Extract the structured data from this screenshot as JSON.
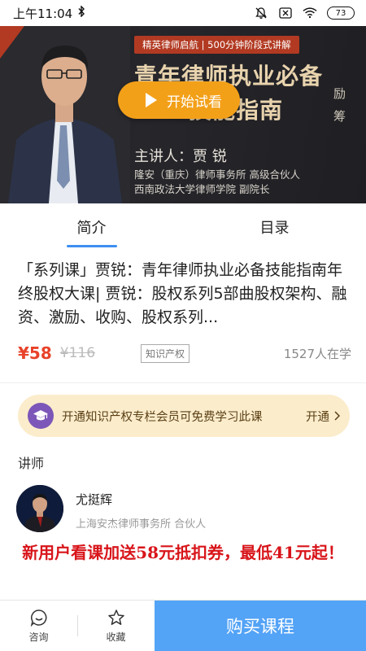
{
  "status_bar": {
    "time": "上午11:04",
    "battery": "73"
  },
  "hero": {
    "tagline": "精英律师启航 | 500分钟阶段式讲解",
    "title_line1": "青年律师执业必备",
    "title_line2": "技能指南",
    "side_text1": "励",
    "side_text2": "筹",
    "presenter": "主讲人：贾 锐",
    "org_line1": "隆安（重庆）律师事务所  高级合伙人",
    "org_line2": "西南政法大学律师学院  副院长",
    "play_label": "开始试看"
  },
  "tabs": [
    {
      "label": "简介",
      "active": true
    },
    {
      "label": "目录",
      "active": false
    }
  ],
  "course": {
    "title": "「系列课」贾锐：青年律师执业必备技能指南年终股权大课| 贾锐：股权系列5部曲股权架构、融资、激励、收购、股权系列...",
    "price": "¥58",
    "original_price": "¥116",
    "tag": "知识产权",
    "learners": "1527人在学"
  },
  "membership": {
    "text": "开通知识产权专栏会员可免费学习此课",
    "action": "开通"
  },
  "teacher_section": {
    "label": "讲师",
    "name": "尤挺辉",
    "org": "上海安杰律师事务所 合伙人"
  },
  "promo": "新用户看课加送58元抵扣券，最低41元起！",
  "bottom_bar": {
    "consult": "咨询",
    "favorite": "收藏",
    "buy": "购买课程"
  },
  "colors": {
    "accent": "#3d8ff0",
    "price": "#e8422a",
    "buy_button": "#53a3f6",
    "promo": "#d8141a",
    "play_button": "#f3a019"
  }
}
